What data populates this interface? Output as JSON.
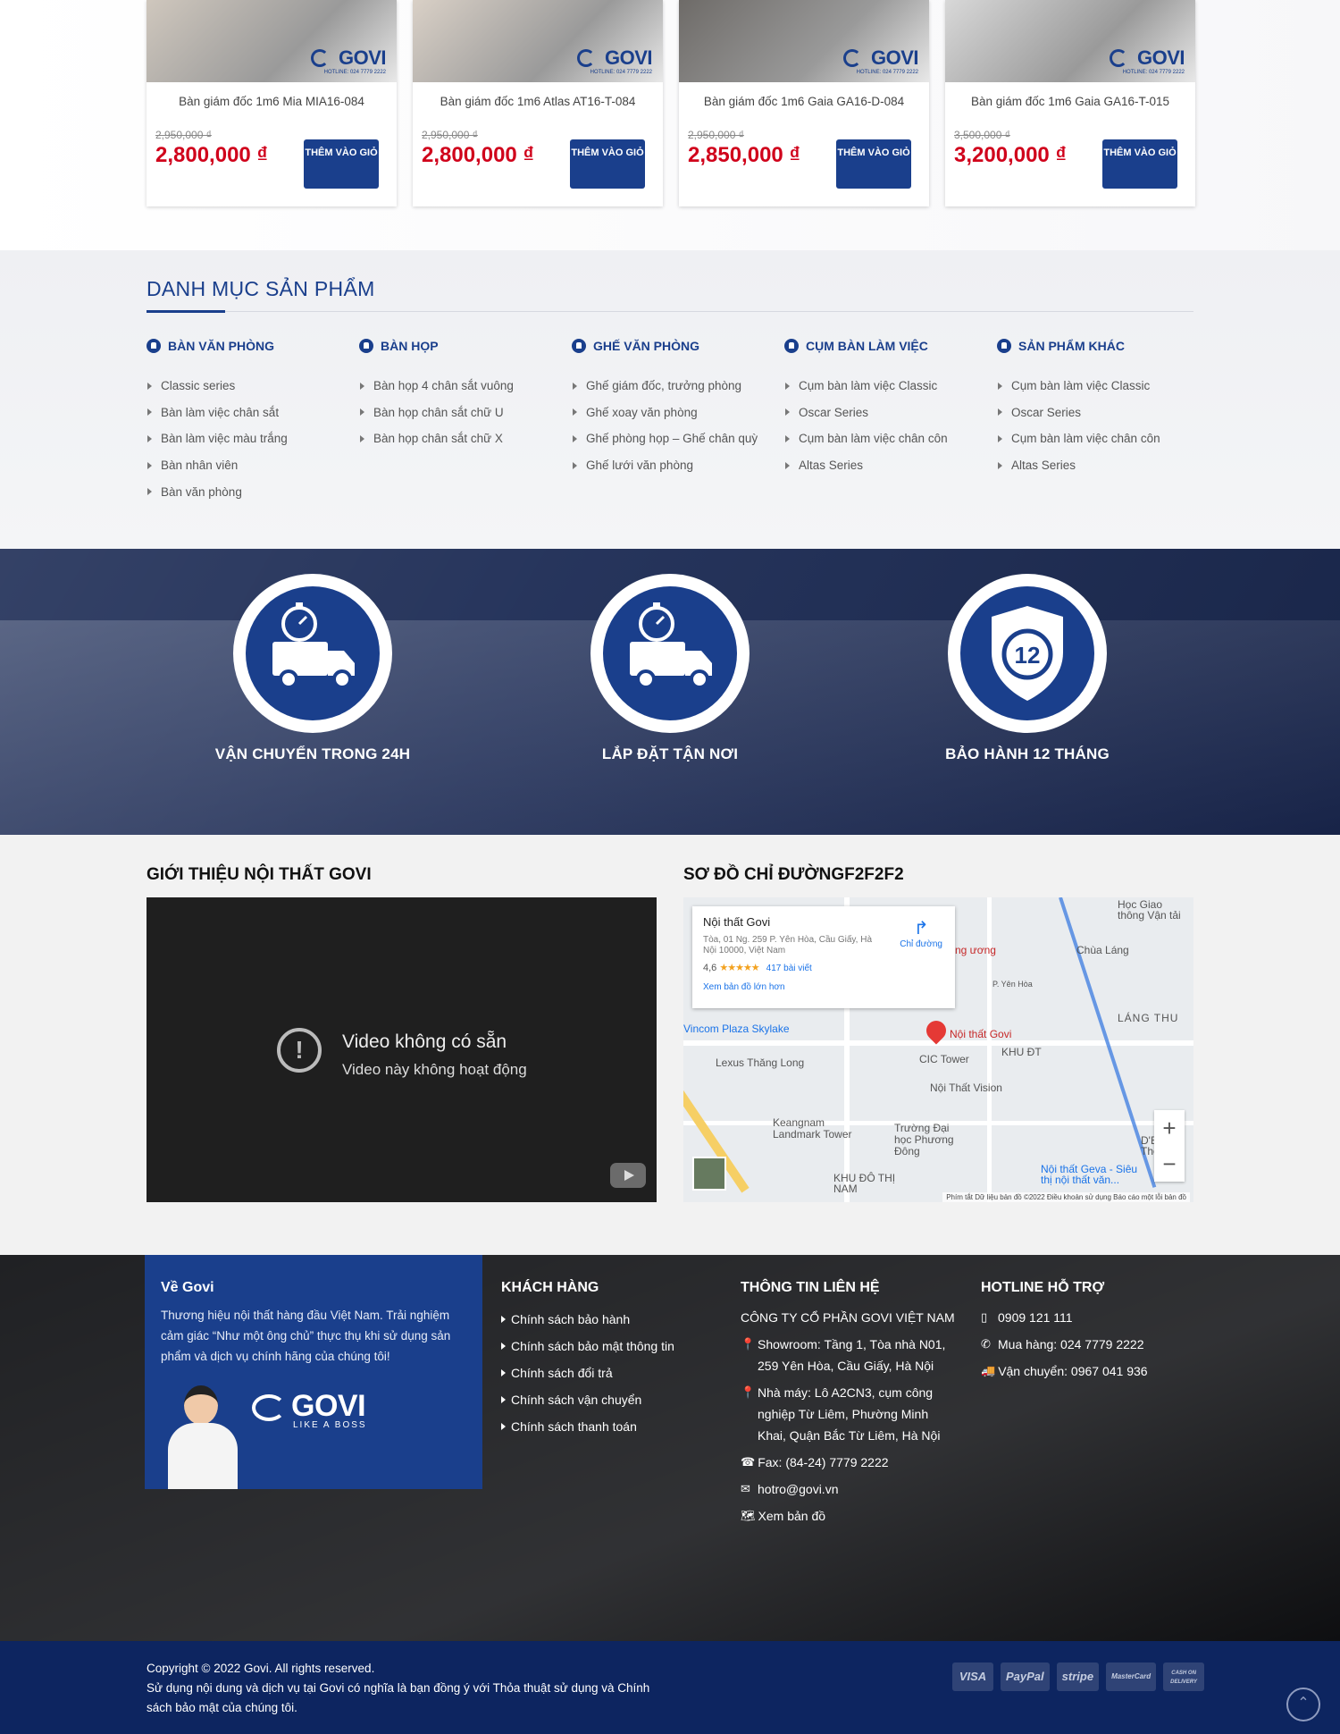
{
  "products": [
    {
      "title": "Bàn giám đốc 1m6 Mia MIA16-084",
      "old_price": "2,950,000 ₫",
      "price": "2,800,000 ₫",
      "btn": "THÊM VÀO GIỎ",
      "bg": "#cfc7bd"
    },
    {
      "title": "Bàn giám đốc 1m6 Atlas AT16-T-084",
      "old_price": "2,950,000 ₫",
      "price": "2,800,000 ₫",
      "btn": "THÊM VÀO GIỎ",
      "bg": "#d9d0c6"
    },
    {
      "title": "Bàn giám đốc 1m6 Gaia GA16-D-084",
      "old_price": "2,950,000 ₫",
      "price": "2,850,000 ₫",
      "btn": "THÊM VÀO GIỎ",
      "bg": "#6e6b68"
    },
    {
      "title": "Bàn giám đốc 1m6 Gaia GA16-T-015",
      "old_price": "3,500,000 ₫",
      "price": "3,200,000 ₫",
      "btn": "THÊM VÀO GIỎ",
      "bg": "#d8d8d8"
    }
  ],
  "product_logo": {
    "brand": "GOVI",
    "hotline": "HOTLINE: 024 7779 2222"
  },
  "categories": {
    "heading": "DANH MỤC SẢN PHẨM",
    "columns": [
      {
        "title": "BÀN VĂN PHÒNG",
        "items": [
          "Classic series",
          "Bàn làm việc chân sắt",
          "Bàn làm việc màu trắng",
          "Bàn nhân viên",
          "Bàn văn phòng"
        ]
      },
      {
        "title": "BÀN HỌP",
        "items": [
          "Bàn họp 4 chân sắt vuông",
          "Bàn họp chân sắt chữ U",
          "Bàn họp chân sắt chữ X"
        ]
      },
      {
        "title": "GHẾ VĂN PHÒNG",
        "items": [
          "Ghế giám đốc, trưởng phòng",
          "Ghế xoay văn phòng",
          "Ghế phòng họp – Ghế chân quỳ",
          "Ghế lưới văn phòng"
        ]
      },
      {
        "title": "CỤM BÀN LÀM VIỆC",
        "items": [
          "Cụm bàn làm việc Classic",
          "Oscar Series",
          "Cụm bàn làm việc chân côn",
          "Altas Series"
        ]
      },
      {
        "title": "SẢN PHẨM KHÁC",
        "items": [
          "Cụm bàn làm việc Classic",
          "Oscar Series",
          "Cụm bàn làm việc chân côn",
          "Altas Series"
        ]
      }
    ]
  },
  "features": [
    {
      "label": "VẬN CHUYỂN TRONG 24H",
      "icon": "delivery-truck-icon"
    },
    {
      "label": "LẮP ĐẶT TẬN NƠI",
      "icon": "delivery-truck-icon"
    },
    {
      "label": "BẢO HÀNH 12 THÁNG",
      "icon": "warranty-badge-icon",
      "badge_number": "12"
    }
  ],
  "intro": {
    "heading": "GIỚI THIỆU NỘI THẤT GOVI",
    "video_title": "Video không có sẵn",
    "video_sub": "Video này không hoạt động",
    "map_heading": "SƠ ĐỒ CHỈ ĐƯỜNGF2F2F2"
  },
  "map": {
    "place": "Nội thất Govi",
    "address": "Tòa, 01 Ng. 259 P. Yên Hòa, Cầu Giấy, Hà Nội 10000, Việt Nam",
    "rating": "4,6",
    "stars": "★★★★★",
    "reviews": "417 bài viết",
    "bigger": "Xem bản đồ lớn hơn",
    "directions": "Chỉ đường",
    "labels": [
      "Vincom Plaza Skylake",
      "Lexus Thăng Long",
      "CIC Tower",
      "KHU ĐT",
      "Nội Thất Vision",
      "Keangnam Landmark Tower",
      "Trường Đại học Phương Đông",
      "KHU ĐÔ THỊ NAM",
      "Nội thất Geva - Siêu thị nội thất văn...",
      "LÁNG THU",
      "Chùa Láng",
      "Học Giao thông Vận tải",
      "Nội thất Govi",
      "ng ương",
      "P. Yên Hòa",
      "D'Era Thông"
    ],
    "attrib": "Phím tắt   Dữ liệu bản đồ ©2022   Điều khoản sử dụng   Báo cáo một lỗi bản đồ"
  },
  "footer": {
    "about_title": "Về Govi",
    "about_text": "Thương hiệu nội thất hàng đầu Việt Nam. Trải nghiệm cảm giác “Như một ông chủ” thực thụ khi sử dụng sản phẩm và dịch vụ chính hãng của chúng tôi!",
    "about_brand": "GOVI",
    "about_tagline": "LIKE A BOSS",
    "customer_title": "KHÁCH HÀNG",
    "customer_links": [
      "Chính sách bảo hành",
      "Chính sách bảo mật thông tin",
      "Chính sách đổi trả",
      "Chính sách vận chuyển",
      "Chính sách thanh toán"
    ],
    "contact_title": "THÔNG TIN LIÊN HỆ",
    "contact_company": "CÔNG TY CỔ PHẦN GOVI VIỆT NAM",
    "contact_showroom": "Showroom: Tầng 1, Tòa nhà N01, 259 Yên Hòa, Cầu Giấy, Hà Nội",
    "contact_factory": "Nhà máy: Lô A2CN3, cụm công nghiệp Từ Liêm, Phường Minh Khai, Quận Bắc Từ Liêm, Hà Nội",
    "contact_fax": "Fax: (84-24) 7779 2222",
    "contact_email": "hotro@govi.vn",
    "contact_map": "Xem bản đồ",
    "hotline_title": "HOTLINE HỖ TRỢ",
    "hotline_mobile": "0909 121 111",
    "hotline_buy": "Mua hàng: 024 7779 2222",
    "hotline_ship": "Vận chuyển: 0967 041 936"
  },
  "copyright": {
    "line1": "Copyright © 2022 Govi. All rights reserved.",
    "line2": "Sử dụng nội dung và dịch vụ tại Govi có nghĩa là bạn đồng ý với Thỏa thuật sử dụng và Chính sách bảo mật của chúng tôi.",
    "payments": [
      "VISA",
      "PayPal",
      "stripe",
      "MasterCard",
      "CASH ON DELIVERY"
    ]
  },
  "colors": {
    "brand_blue": "#1a3f8c",
    "price_red": "#d0021b",
    "footer_bar": "#0d2560"
  }
}
